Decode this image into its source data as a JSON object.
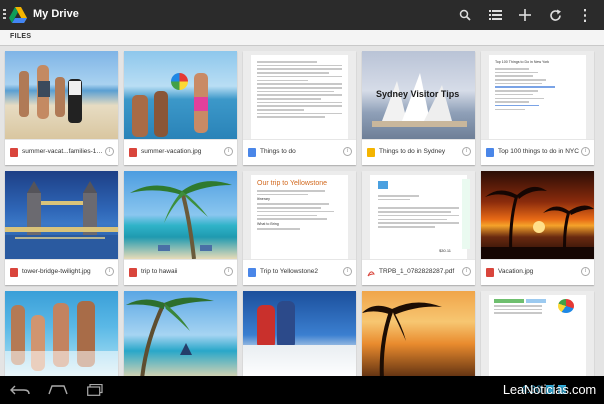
{
  "app": {
    "title": "My Drive"
  },
  "section": {
    "label": "FILES"
  },
  "doc_texts": {
    "sydney_title": "Sydney Visitor Tips",
    "nyc_title": "Top 100 Things to Do in New York",
    "yellowstone_title": "Our trip to Yellowstone",
    "yellowstone_sub1": "Itinerary",
    "yellowstone_sub2": "What to Bring"
  },
  "pdf_text": {
    "amount": "$30.11"
  },
  "files": [
    {
      "name": "summer-vacat...families-1.jpg",
      "type": "image"
    },
    {
      "name": "summer-vacation.jpg",
      "type": "image"
    },
    {
      "name": "Things to do",
      "type": "document"
    },
    {
      "name": "Things to do in Sydney",
      "type": "presentation"
    },
    {
      "name": "Top 100 things to do in NYC",
      "type": "document"
    },
    {
      "name": "tower-bridge-twilight.jpg",
      "type": "image"
    },
    {
      "name": "trip to hawaii",
      "type": "image"
    },
    {
      "name": "Trip to Yellowstone2",
      "type": "document"
    },
    {
      "name": "TRPB_1_0782828287.pdf",
      "type": "pdf"
    },
    {
      "name": "Vacation.jpg",
      "type": "image"
    },
    {
      "name": "",
      "type": "image"
    },
    {
      "name": "",
      "type": "image"
    },
    {
      "name": "",
      "type": "image"
    },
    {
      "name": "",
      "type": "image"
    },
    {
      "name": "",
      "type": "spreadsheet"
    }
  ],
  "status": {
    "clock": "4:30"
  },
  "watermark": "LeaNoticias.com",
  "icons": [
    "menu-icon",
    "drive-logo-icon",
    "search-icon",
    "list-view-icon",
    "add-icon",
    "refresh-icon",
    "overflow-menu-icon",
    "back-icon",
    "home-icon",
    "recent-apps-icon"
  ],
  "colors": {
    "actionbar": "#2b2b2b",
    "accent": "#33b5e5",
    "grid_bg": "#e4e4e4"
  }
}
